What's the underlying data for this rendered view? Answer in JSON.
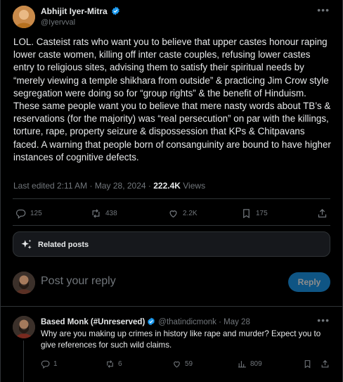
{
  "tweet": {
    "author_name": "Abhijit Iyer-Mitra",
    "author_handle": "@Iyervval",
    "text": "LOL. Casteist rats who want you to believe that upper castes honour raping lower caste women, killing off inter caste couples, refusing lower castes entry to religious sites, advising them to satisfy their spiritual needs by “merely viewing a temple shikhara from outside” & practicing Jim Crow style segregation were doing so for “group rights” & the benefit of Hinduism. These same people want you to believe that mere nasty words about TB’s & reservations (for the majority) was “real persecution” on par with the killings, torture, rape, property seizure & dispossession that KPs & Chitpavans faced. A warning that people born of consanguinity are bound to have higher instances of cognitive defects.",
    "edited_label": "Last edited 2:11 AM · May 28, 2024 · ",
    "views_count": "222.4K",
    "views_label": " Views",
    "replies": "125",
    "reposts": "438",
    "likes": "2.2K",
    "bookmarks": "175"
  },
  "related_posts_label": "Related posts",
  "reply_box": {
    "placeholder": "Post your reply",
    "button_label": "Reply"
  },
  "comment": {
    "author_name": "Based Monk (#Unreserved)",
    "author_handle": "@thatindicmonk",
    "date": " · May 28",
    "text": "Why are you making up crimes in history like rape and murder? Expect you to give references for such wild claims.",
    "replies": "1",
    "reposts": "6",
    "likes": "59",
    "views": "809"
  },
  "icons": {
    "verified": "verified-badge-icon",
    "more": "more-icon",
    "reply": "reply-icon",
    "repost": "repost-icon",
    "like": "like-icon",
    "bookmark": "bookmark-icon",
    "share": "share-icon",
    "views": "views-icon",
    "sparkle": "sparkle-icon"
  },
  "colors": {
    "background": "#000000",
    "text": "#e7e9ea",
    "muted": "#71767b",
    "accent": "#1d9bf0",
    "border": "#2f3336"
  }
}
